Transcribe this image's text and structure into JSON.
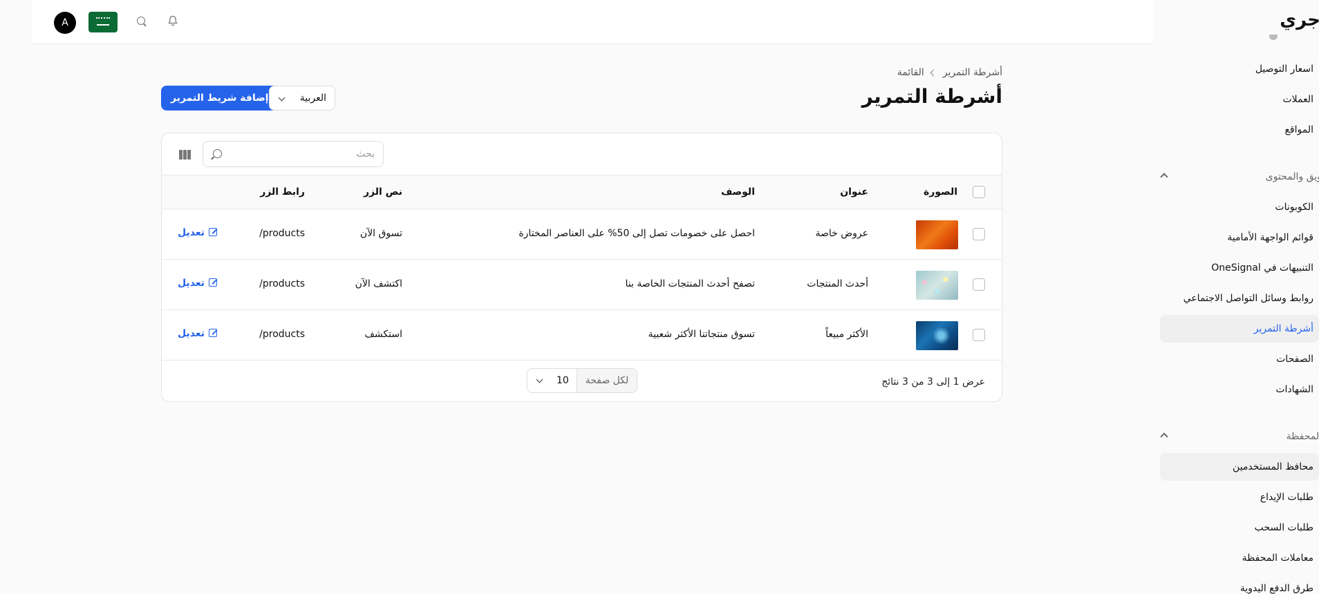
{
  "app": {
    "brand": "جري"
  },
  "header": {
    "avatar_letter": "A"
  },
  "sidebar": {
    "links_top": [
      "اسعار التوصيل",
      "العملات",
      "المواقع"
    ],
    "group_marketing": "ويق والمحتوى",
    "marketing_links": [
      "الكوبونات",
      "قوائم الواجهة الأمامية",
      "التنبيهات في OneSignal",
      "روابط وسائل التواصل الاجتماعي",
      "أشرطة التمرير",
      "الصفحات",
      "الشهادات"
    ],
    "group_wallet": "المحفظة",
    "wallet_links": [
      "محافظ المستخدمين",
      "طلبات الإيداع",
      "طلبات السحب",
      "معاملات المحفظة",
      "طرق الدفع اليدوية"
    ],
    "active_color": "#2563eb"
  },
  "breadcrumb": {
    "parent": "أشرطة التمرير",
    "current": "القائمة"
  },
  "page": {
    "title": "أشرطة التمرير",
    "add_button": "إضافة شريط التمرير",
    "language_value": "العربية"
  },
  "table": {
    "search_placeholder": "بحث",
    "columns": [
      "الصورة",
      "عنوان",
      "الوصف",
      "نص الزر",
      "رابط الزر"
    ],
    "edit_label": "تعديل",
    "rows": [
      {
        "title": "عروض خاصة",
        "description": "احصل على خصومات تصل إلى 50% على العناصر المختارة",
        "button_text": "تسوق الآن",
        "button_link": "/products"
      },
      {
        "title": "أحدث المنتجات",
        "description": "تصفح أحدث المنتجات الخاصة بنا",
        "button_text": "اكتشف الآن",
        "button_link": "/products"
      },
      {
        "title": "الأكثر مبيعاً",
        "description": "تسوق منتجاتنا الأكثر شعبية",
        "button_text": "استكشف",
        "button_link": "/products"
      }
    ],
    "footer_text": "عرض 1 إلى 3 من 3 نتائج",
    "per_page_label": "لكل صفحة",
    "per_page_value": "10"
  },
  "colors": {
    "primary": "#2563eb",
    "flag_green": "#0b6b34"
  },
  "icons": [
    "search-icon",
    "bell-icon",
    "flag-icon",
    "columns-icon",
    "edit-icon",
    "chevron-down-icon",
    "chevron-up-icon",
    "chevron-left-icon"
  ]
}
